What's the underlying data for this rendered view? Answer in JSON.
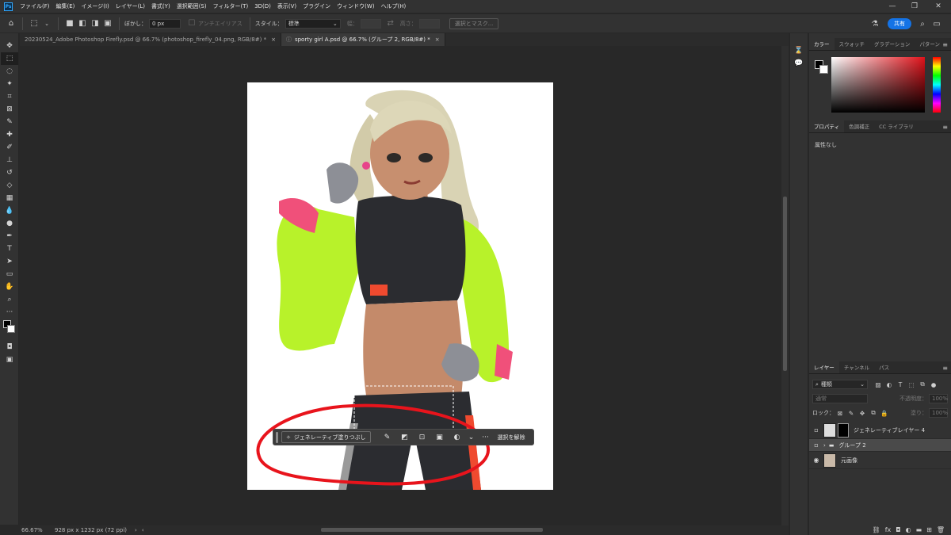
{
  "menubar": {
    "logo": "Ps",
    "items": [
      "ファイル(F)",
      "編集(E)",
      "イメージ(I)",
      "レイヤー(L)",
      "書式(Y)",
      "選択範囲(S)",
      "フィルター(T)",
      "3D(D)",
      "表示(V)",
      "プラグイン",
      "ウィンドウ(W)",
      "ヘルプ(H)"
    ]
  },
  "optionsbar": {
    "feather_label": "ぼかし：",
    "feather_value": "0 px",
    "antialias_label": "アンチエイリアス",
    "style_label": "スタイル：",
    "style_value": "標準",
    "width_label": "幅：",
    "height_label": "高さ：",
    "select_mask_label": "選択とマスク...",
    "share_label": "共有"
  },
  "tabs": [
    {
      "label": "20230524_Adobe Photoshop Firefly.psd @ 66.7% (photoshop_firefly_04.png, RGB/8#) *",
      "close": "×"
    },
    {
      "label": "sporty girl A.psd @ 66.7% (グループ 2, RGB/8#) *",
      "close": "×"
    }
  ],
  "taskbar": {
    "generative_fill_label": "ジェネレーティブ塗りつぶし",
    "more_label": "···",
    "deselect_label": "選択を解除"
  },
  "statusbar": {
    "zoom": "66.67%",
    "dimensions": "928 px x 1232 px (72 ppi)"
  },
  "color_panel": {
    "tabs": [
      "カラー",
      "スウォッチ",
      "グラデーション",
      "パターン"
    ]
  },
  "properties_panel": {
    "tabs": [
      "プロパティ",
      "色調補正",
      "CC ライブラリ"
    ],
    "no_attributes": "属性なし"
  },
  "layers_panel": {
    "tabs": [
      "レイヤー",
      "チャンネル",
      "パス"
    ],
    "kind_label": "種類",
    "blend_mode": "通常",
    "opacity_label": "不透明度：",
    "opacity_value": "100%",
    "lock_label": "ロック：",
    "fill_label": "塗り：",
    "fill_value": "100%",
    "layers": [
      {
        "name": "ジェネレーティブレイヤー 4",
        "visible": false
      },
      {
        "name": "グループ 2",
        "visible": false
      },
      {
        "name": "元画像",
        "visible": true
      }
    ]
  },
  "colors": {
    "accent": "#1473e6",
    "annotation_red": "#e8141c",
    "jacket_green": "#b8f22a",
    "jacket_pink": "#f0507a"
  }
}
